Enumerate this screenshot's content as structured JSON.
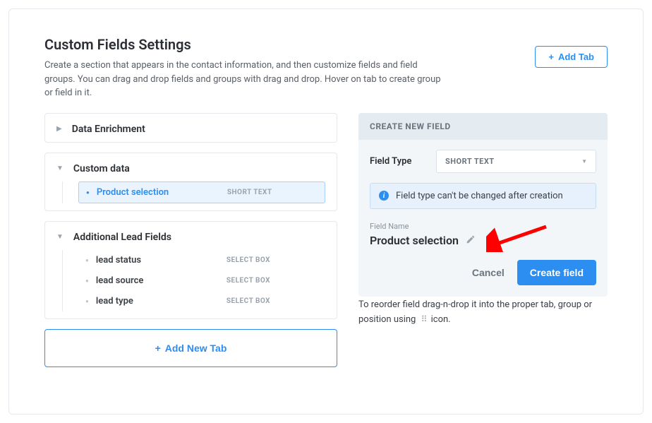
{
  "header": {
    "title": "Custom Fields Settings",
    "description": "Create a section that appears in the contact information, and then customize fields and field groups. You can drag and drop fields and groups with drag and drop. Hover on tab to create group or field in it.",
    "add_tab_label": "Add Tab"
  },
  "sections": {
    "data_enrichment": {
      "title": "Data Enrichment"
    },
    "custom_data": {
      "title": "Custom data",
      "fields": [
        {
          "label": "Product selection",
          "type": "SHORT TEXT",
          "selected": true
        }
      ]
    },
    "additional_lead_fields": {
      "title": "Additional Lead Fields",
      "fields": [
        {
          "label": "lead status",
          "type": "SELECT BOX"
        },
        {
          "label": "lead source",
          "type": "SELECT BOX"
        },
        {
          "label": "lead type",
          "type": "SELECT BOX"
        }
      ]
    },
    "add_new_tab_label": "Add New Tab"
  },
  "create_panel": {
    "header": "CREATE NEW FIELD",
    "field_type_label": "Field Type",
    "field_type_value": "SHORT TEXT",
    "info_text": "Field type can't be changed after creation",
    "field_name_label": "Field Name",
    "field_name_value": "Product selection",
    "cancel_label": "Cancel",
    "create_label": "Create field"
  },
  "helper": {
    "text_before": "To reorder field drag-n-drop it into the proper tab, group or position using",
    "text_after": "icon."
  },
  "colors": {
    "accent": "#2c8ef1",
    "arrow": "#ff0000"
  }
}
